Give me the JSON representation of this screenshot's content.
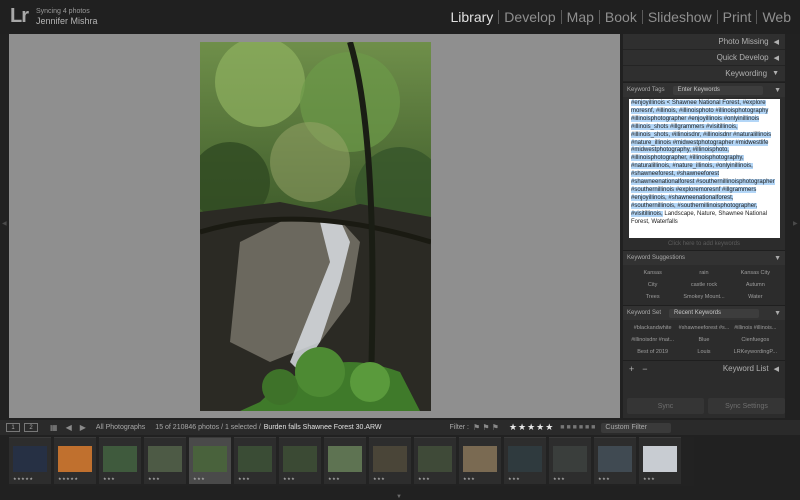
{
  "app": {
    "logo": "Lr",
    "sync_status": "Syncing 4 photos",
    "user": "Jennifer Mishra"
  },
  "modules": [
    "Library",
    "Develop",
    "Map",
    "Book",
    "Slideshow",
    "Print",
    "Web"
  ],
  "active_module": "Library",
  "right_panel": {
    "photo_missing": "Photo Missing",
    "quick_develop": "Quick Develop",
    "keywording": "Keywording",
    "keyword_tags_label": "Keyword Tags",
    "keyword_tags_mode": "Enter Keywords",
    "keywords_selected": "#enjoyillinois < Shawnee National Forest, #explore moresnf, #illinois, #illinoisphoto #illinoisphotography #illinoisphotographer #enjoyillinois #onlyinillinois #illinois_shots #illgrammers #visitillinois, #illinois_shots, #illinoisdnr, #illinoisdnr #naturalillinois #nature_illinois #midwestphotographer #midwestlife #midwestphotography, #illinoisphoto, #illinoisphotographer, #illinoisphotography, #naturalillinois, #nature_illinois, #onlyinillinois, #shawneeforest, #shawneeforest #shawneenationalforest #southernillinoisphotographer #southernillinois #exploremoresnf #illgrammers #enjoyillinois, #shawneenationalforest, #southernillinois, #southernillinoisphotographer, #visitillinois,",
    "keywords_plain": "Landscape, Nature, Shawnee National Forest, Waterfalls",
    "keyword_hint": "Click here to add keywords",
    "suggestions_label": "Keyword Suggestions",
    "suggestions": [
      "Kansas",
      "rain",
      "Kansas City",
      "City",
      "castle rock",
      "Autumn",
      "Trees",
      "Smokey Mount...",
      "Water"
    ],
    "keyword_set_label": "Keyword Set",
    "keyword_set_value": "Recent Keywords",
    "keyword_set_items": [
      "#blackandwhite",
      "#shawneeforest #s...",
      "#illinois #illinois...",
      "#illinoisdnr #nat...",
      "Blue",
      "Cienfuegos",
      "Best of 2019",
      "Louis",
      "LRKeywordingP..."
    ],
    "keyword_list": "Keyword List",
    "sync": "Sync",
    "sync_settings": "Sync Settings"
  },
  "filmstrip_bar": {
    "page1": "1",
    "page2": "2",
    "source": "All Photographs",
    "count": "15 of 210846 photos / 1 selected /",
    "filename": "Burden falls Shawnee Forest 30.ARW",
    "filter_label": "Filter :",
    "star_rating": 3,
    "custom_filter": "Custom Filter"
  },
  "thumb_colors": [
    "#263044",
    "#c0702e",
    "#3f5a3d",
    "#4d5a45",
    "#49623c",
    "#3a4c35",
    "#3b4a34",
    "#5e7352",
    "#4a4538",
    "#3f4a38",
    "#7a6a52",
    "#2f3a3e",
    "#3a3e3c",
    "#404a52",
    "#c8ccd2"
  ],
  "colors": {
    "accent_text": "#e0e0e0",
    "selection": "#b3d6f7"
  }
}
